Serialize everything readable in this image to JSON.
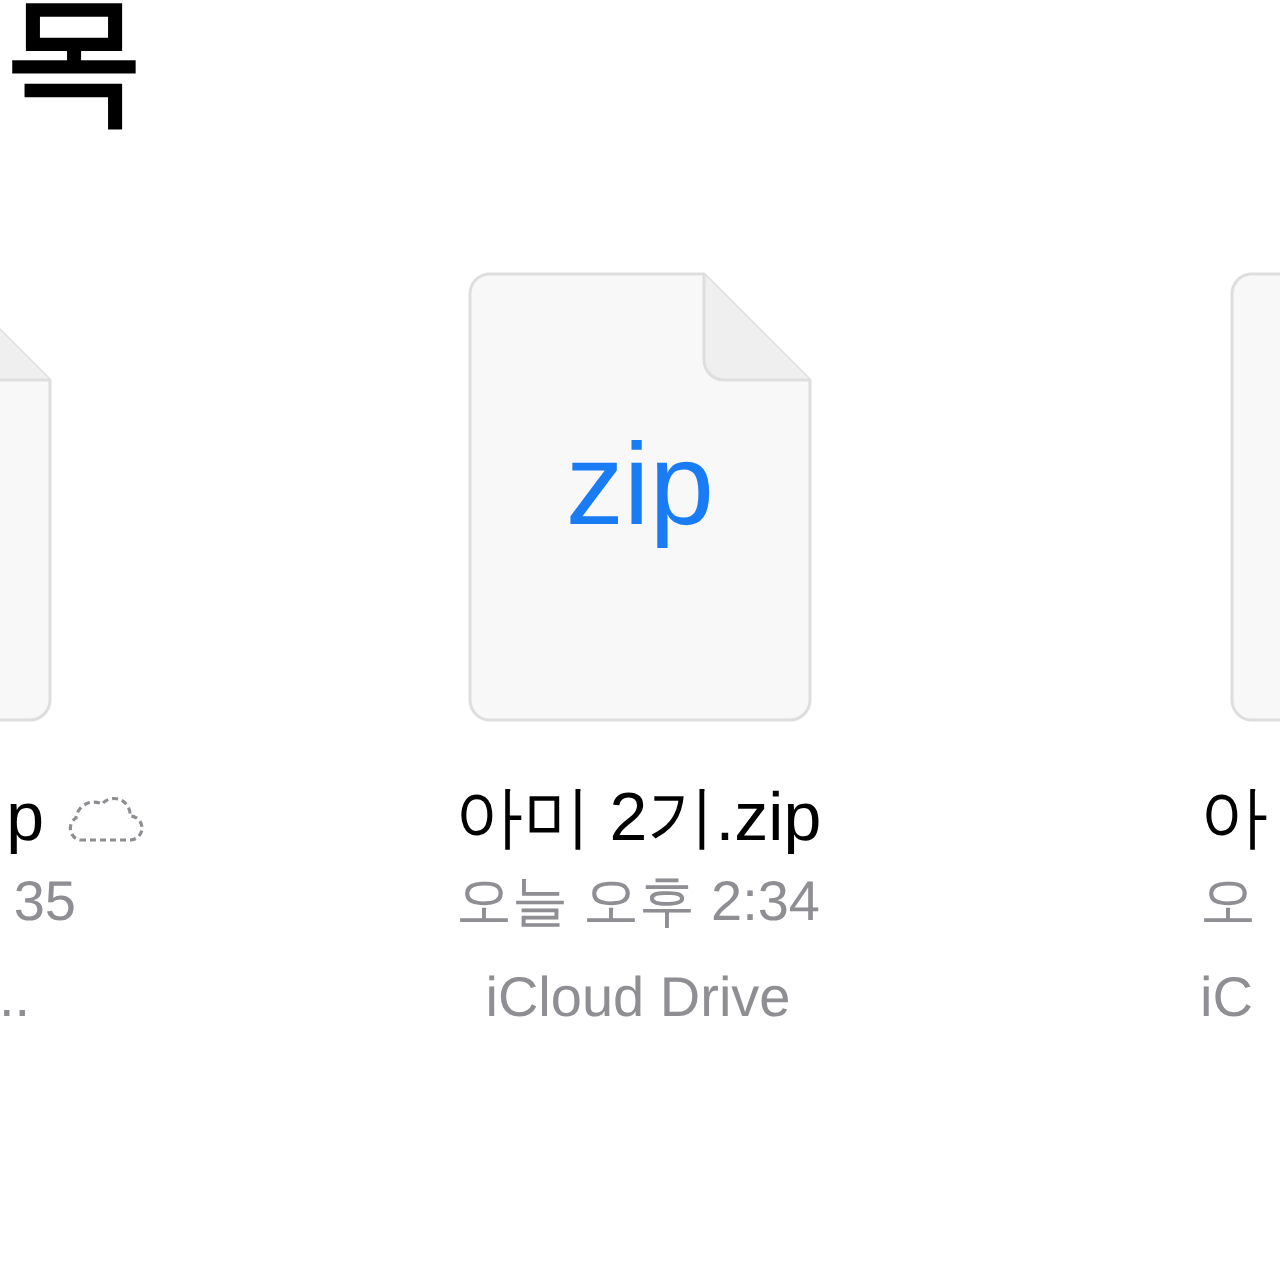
{
  "title": "목",
  "files": [
    {
      "kind": "left",
      "name": "p",
      "cloud_only": true,
      "date": "35",
      "location": ".."
    },
    {
      "kind": "center",
      "badge": "zip",
      "name": "아미 2기.zip",
      "cloud_only": false,
      "date": "오늘 오후 2:34",
      "location": "iCloud Drive"
    },
    {
      "kind": "right",
      "name": "아",
      "cloud_only": false,
      "date": "오",
      "location": "iC"
    }
  ]
}
